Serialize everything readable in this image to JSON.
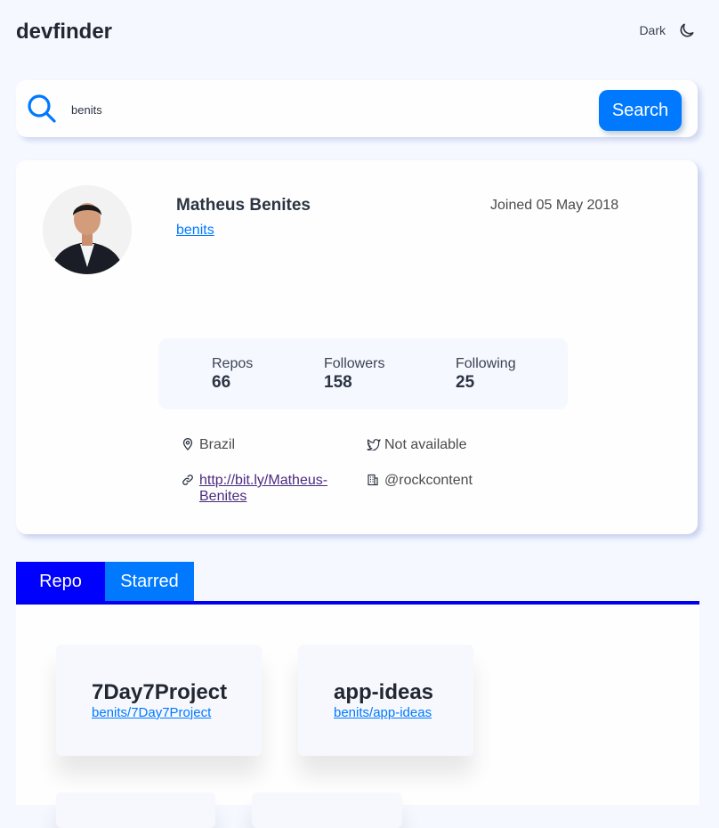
{
  "app": {
    "title": "devfinder"
  },
  "theme_toggle": {
    "label": "Dark",
    "icon": "moon-icon"
  },
  "search": {
    "value": "benits",
    "button_label": "Search",
    "icon": "search-icon"
  },
  "profile": {
    "name": "Matheus Benites",
    "login": "benits",
    "joined": "Joined 05 May 2018",
    "stats": {
      "repos_label": "Repos",
      "repos": "66",
      "followers_label": "Followers",
      "followers": "158",
      "following_label": "Following",
      "following": "25"
    },
    "location": "Brazil",
    "twitter": "Not available",
    "blog": "http://bit.ly/Matheus-Benites",
    "company": "@rockcontent"
  },
  "tabs": [
    {
      "label": "Repo",
      "active": true
    },
    {
      "label": "Starred",
      "active": false
    }
  ],
  "repos": [
    {
      "name": "7Day7Project",
      "full_name": "benits/7Day7Project"
    },
    {
      "name": "app-ideas",
      "full_name": "benits/app-ideas"
    }
  ],
  "colors": {
    "accent": "#0079ff",
    "active_tab": "#0000ff",
    "background": "#f5f8ff",
    "card": "#fefefe",
    "text": "#2b3442"
  }
}
